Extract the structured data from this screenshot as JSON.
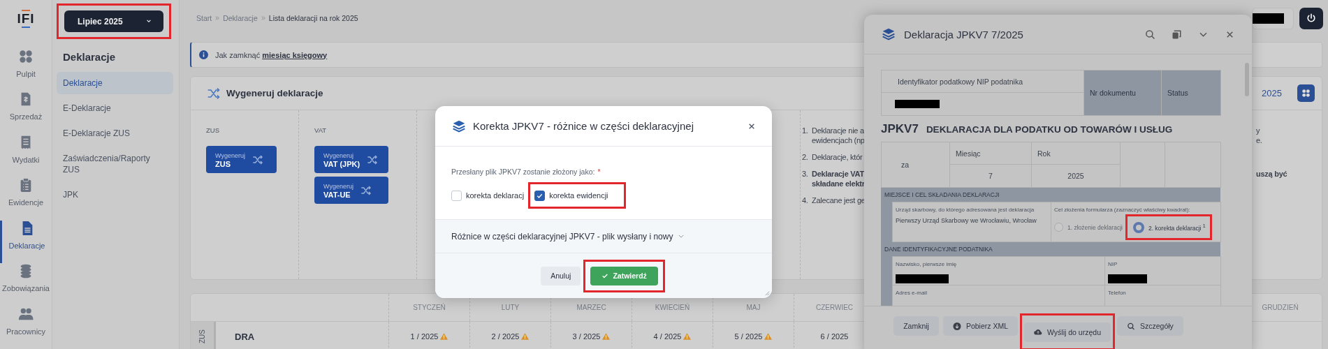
{
  "logo": {
    "text": "IFI"
  },
  "rail": [
    {
      "label": "Pulpit",
      "kind": "dots",
      "selected": false
    },
    {
      "label": "Sprzedaż",
      "kind": "invoice",
      "selected": false
    },
    {
      "label": "Wydatki",
      "kind": "receipt",
      "selected": false
    },
    {
      "label": "Ewidencje",
      "kind": "clipboard",
      "selected": false
    },
    {
      "label": "Deklaracje",
      "kind": "document",
      "selected": true
    },
    {
      "label": "Zobowiązania",
      "kind": "coins",
      "selected": false
    },
    {
      "label": "Pracownicy",
      "kind": "people",
      "selected": false
    }
  ],
  "period_button": {
    "label": "Lipiec 2025"
  },
  "sidebar": {
    "title": "Deklaracje",
    "items": [
      {
        "label": "Deklaracje",
        "selected": true
      },
      {
        "label": "E-Deklaracje",
        "selected": false
      },
      {
        "label": "E-Deklaracje ZUS",
        "selected": false
      },
      {
        "label": "Zaświadczenia/Raporty ZUS",
        "selected": false
      },
      {
        "label": "JPK",
        "selected": false
      }
    ]
  },
  "breadcrumb": [
    "Start",
    "Deklaracje",
    "Lista deklaracji na rok 2025"
  ],
  "info": {
    "text": "Jak zamknąć",
    "link": "miesiąc księgowy"
  },
  "generate_card": {
    "title": "Wygeneruj deklaracje",
    "year": "2025",
    "groups": [
      {
        "label": "ZUS",
        "buttons": [
          {
            "top": "Wygeneruj",
            "main": "ZUS"
          }
        ]
      },
      {
        "label": "VAT",
        "buttons": [
          {
            "top": "Wygeneruj",
            "main": "VAT (JPK)"
          },
          {
            "top": "Wygeneruj",
            "main": "VAT-UE"
          }
        ]
      }
    ],
    "notes": [
      {
        "number": "1.",
        "bold": false,
        "lines": [
          {
            "text": "Deklaracje nie a",
            "tail": "y"
          },
          {
            "text": "ewidencjach (np",
            "tail": "e."
          }
        ]
      },
      {
        "number": "2.",
        "bold": false,
        "lines": [
          {
            "text": "Deklaracje, któr"
          }
        ]
      },
      {
        "number": "3.",
        "bold": true,
        "lines": [
          {
            "text": "Deklaracje VAT",
            "tail": "uszą być"
          },
          {
            "text": "składane elektr"
          }
        ]
      },
      {
        "number": "4.",
        "bold": false,
        "lines": [
          {
            "text": "Zalecane jest ge"
          }
        ]
      }
    ]
  },
  "table": {
    "columns": [
      "STYCZEŃ",
      "LUTY",
      "MARZEC",
      "KWIECIEŃ",
      "MAJ",
      "CZERWIEC"
    ],
    "last_column": "GRUDZIEŃ",
    "rows": [
      {
        "group": "ZUS",
        "name": "DRA",
        "cells": [
          {
            "text": "1 / 2025",
            "warning": true
          },
          {
            "text": "2 / 2025",
            "warning": true
          },
          {
            "text": "3 / 2025",
            "warning": true
          },
          {
            "text": "4 / 2025",
            "warning": true
          },
          {
            "text": "5 / 2025",
            "warning": true
          },
          {
            "text": "6 / 2025",
            "warning": false
          }
        ]
      }
    ]
  },
  "dialog": {
    "title": "Korekta JPKV7 - różnice w części deklaracyjnej",
    "question": "Przesłany plik JPKV7 zostanie złożony jako:",
    "required_mark": "*",
    "options": [
      {
        "label": "korekta deklaracj",
        "checked": false,
        "highlighted": false
      },
      {
        "label": "korekta ewidencji",
        "checked": true,
        "highlighted": true
      }
    ],
    "accordion": {
      "label": "Różnice w części deklaracyjnej JPKV7 - plik wysłany i nowy",
      "expanded": false
    },
    "buttons": [
      {
        "label": "Anuluj",
        "kind": "secondary",
        "highlighted": false
      },
      {
        "label": "Zatwierdź",
        "kind": "primary",
        "highlighted": true
      }
    ]
  },
  "panel": {
    "title": "Deklaracja JPKV7 7/2025",
    "form": {
      "nip_label": "Identyfikator podatkowy NIP podatnika",
      "doc_label": "Nr dokumentu",
      "status_label": "Status",
      "code": "JPKV7",
      "heading": "DEKLARACJA DLA PODATKU OD TOWARÓW I USŁUG",
      "period_label": "za",
      "month_label": "Miesiąc",
      "month": "7",
      "year_label": "Rok",
      "year": "2025",
      "section1": "MIEJSCE I CEL SKŁADANIA DEKLARACJI",
      "office_label": "Urząd skarbowy, do którego adresowana jest deklaracja",
      "office": "Pierwszy Urząd Skarbowy we Wrocławiu, Wrocław",
      "purpose_label": "Cel złożenia formularza (zaznaczyć właściwy kwadrat):",
      "purposes": [
        {
          "label": "1. złożenie deklaracji",
          "selected": false,
          "highlighted": false
        },
        {
          "label": "2. korekta deklaracji $^{1}$",
          "selected": true,
          "highlighted": true
        }
      ],
      "section2": "DANE IDENTYFIKACYJNE PODATNIKA",
      "name_label": "Nazwisko, pierwsze imię",
      "nip2_label": "NIP",
      "email_label": "Adres e-mail",
      "phone_label": "Telefon"
    },
    "buttons": [
      {
        "label": "Zamknij",
        "kind": "plain",
        "highlighted": false
      },
      {
        "label": "Pobierz XML",
        "kind": "download",
        "highlighted": false
      },
      {
        "label": "Wyślij do urzędu",
        "kind": "upload",
        "highlighted": true
      },
      {
        "label": "Szczegóły",
        "kind": "search",
        "highlighted": false
      }
    ]
  }
}
